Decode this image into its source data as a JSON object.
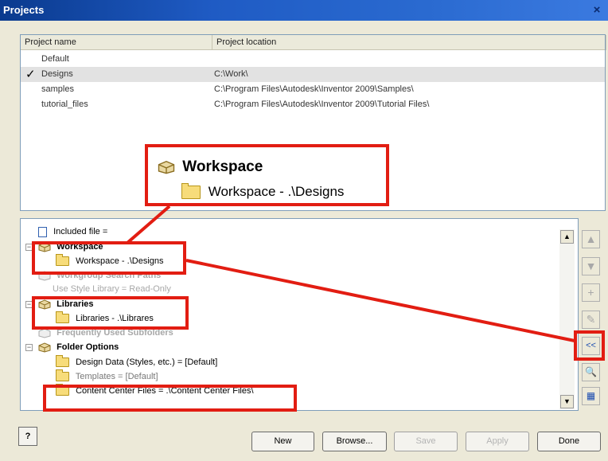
{
  "window": {
    "title": "Projects",
    "close": "×"
  },
  "project_list": {
    "columns": [
      "Project name",
      "Project location"
    ],
    "rows": [
      {
        "name": "Default",
        "location": "",
        "active": false
      },
      {
        "name": "Designs",
        "location": "C:\\Work\\",
        "active": true
      },
      {
        "name": "samples",
        "location": "C:\\Program Files\\Autodesk\\Inventor 2009\\Samples\\",
        "active": false
      },
      {
        "name": "tutorial_files",
        "location": "C:\\Program Files\\Autodesk\\Inventor 2009\\Tutorial Files\\",
        "active": false
      }
    ],
    "active_mark": "✓"
  },
  "callout": {
    "title": "Workspace",
    "subtitle": "Workspace - .\\Designs"
  },
  "tree": {
    "included_file": "Included file =",
    "workspace": "Workspace",
    "workspace_path": "Workspace - .\\Designs",
    "workgroup": "Workgroup Search Paths",
    "use_style": "Use Style Library = Read-Only",
    "libraries": "Libraries",
    "libraries_path": "Libraries - .\\Librares",
    "frequent": "Frequently Used Subfolders",
    "folder_options": "Folder Options",
    "design_data": "Design Data (Styles, etc.) = [Default]",
    "templates": "Templates = [Default]",
    "content_center": "Content Center Files = .\\Content Center Files\\"
  },
  "side_buttons": {
    "up": "▲",
    "down": "▼",
    "add": "+",
    "edit": "✎",
    "collapse": "<<",
    "find": "🔍",
    "save": "▦"
  },
  "buttons": {
    "help": "?",
    "new": "New",
    "browse": "Browse...",
    "save": "Save",
    "apply": "Apply",
    "done": "Done"
  },
  "colors": {
    "callout_red": "#e21d12",
    "title_blue": "#1f5bc4",
    "folder": "#f7dc7a"
  }
}
